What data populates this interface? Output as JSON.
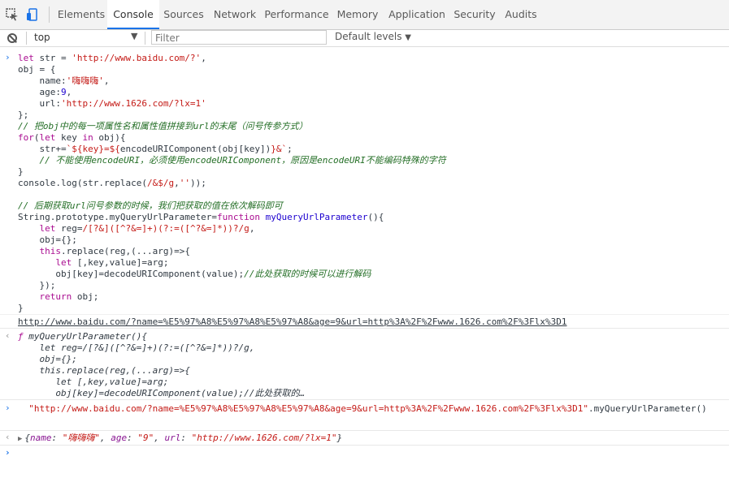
{
  "toolbar": {
    "tabs": [
      "Elements",
      "Console",
      "Sources",
      "Network",
      "Performance",
      "Memory",
      "Application",
      "Security",
      "Audits"
    ],
    "active_tab": "Console"
  },
  "filterbar": {
    "context": "top",
    "filter_placeholder": "Filter",
    "levels": "Default levels"
  },
  "entries": {
    "input1": [
      "let str = 'http://www.baidu.com/?',",
      "obj = {",
      "    name:'嗨嗨嗨',",
      "    age:9,",
      "    url:'http://www.1626.com/?lx=1'",
      "};",
      "// 把obj中的每一项属性名和属性值拼接到url的末尾（问号传参方式）",
      "for(let key in obj){",
      "    str+=`${key}=${encodeURIComponent(obj[key])}&`;",
      "    // 不能使用encodeURI，必须使用encodeURIComponent，原因是encodeURI不能编码特殊的字符",
      "}",
      "console.log(str.replace(/&$/g,''));",
      "",
      "// 后期获取url问号参数的时候，我们把获取的值在依次解码即可",
      "String.prototype.myQueryUrlParameter=function myQueryUrlParameter(){",
      "    let reg=/[?&]([^?&=]+)(?:=([^?&=]*))?/g,",
      "    obj={};",
      "    this.replace(reg,(...arg)=>{",
      "       let [,key,value]=arg;",
      "       obj[key]=decodeURIComponent(value);//此处获取的时候可以进行解码",
      "    });",
      "    return obj;",
      "}"
    ],
    "log1": "http://www.baidu.com/?name=%E5%97%A8%E5%97%A8%E5%97%A8&age=9&url=http%3A%2F%2Fwww.1626.com%2F%3Flx%3D1",
    "result1": [
      "ƒ myQueryUrlParameter(){",
      "    let reg=/[?&]([^?&=]+)(?:=([^?&=]*))?/g,",
      "    obj={};",
      "    this.replace(reg,(...arg)=>{",
      "       let [,key,value]=arg;",
      "       obj[key]=decodeURIComponent(value);//此处获取的…"
    ],
    "input2_string": "\"http://www.baidu.com/?name=%E5%97%A8%E5%97%A8%E5%97%A8&age=9&url=http%3A%2F%2Fwww.1626.com%2F%3Flx%3D1\"",
    "input2_call": ".myQueryUrlParameter()",
    "result2": {
      "open": "{",
      "name_key": "name",
      "name_val": "\"嗨嗨嗨\"",
      "age_key": "age",
      "age_val": "\"9\"",
      "url_key": "url",
      "url_val": "\"http://www.1626.com/?lx=1\"",
      "close": "}"
    }
  }
}
